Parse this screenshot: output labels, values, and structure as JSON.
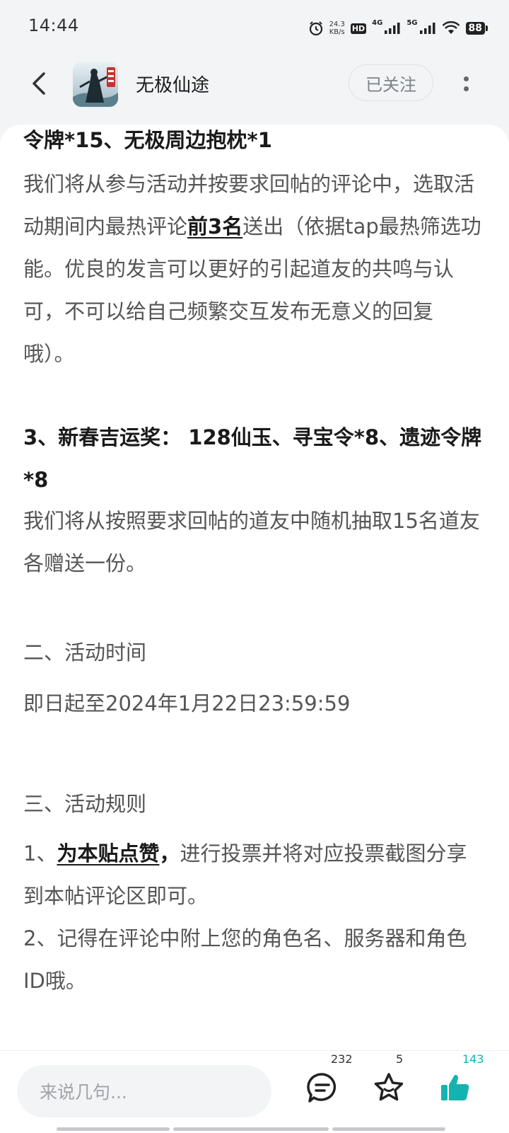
{
  "status_bar": {
    "time": "14:44",
    "net_speed_value": "24.3",
    "net_speed_unit": "KB/s",
    "hd_label": "HD",
    "sig1_label": "4G",
    "sig2_label": "5G",
    "battery": "88"
  },
  "header": {
    "title": "无极仙途",
    "follow_label": "已关注"
  },
  "content": {
    "p1": "令牌*15、无极周边抱枕*1",
    "p2_before": "我们将从参与活动并按要求回帖的评论中，选取活动期间内最热评论",
    "p2_bold": "前3名",
    "p2_after": "送出（依据tap最热筛选功能。优良的发言可以更好的引起道友的共鸣与认可，不可以给自己频繁交互发布无意义的回复哦）。",
    "p3": "3、新春吉运奖： 128仙玉、寻宝令*8、遗迹令牌*8",
    "p4": "我们将从按照要求回帖的道友中随机抽取15名道友各赠送一份。",
    "h2": "二、活动时间",
    "p5": "即日起至2024年1月22日23:59:59",
    "h3": "三、活动规则",
    "rule1_prefix": "1、",
    "rule1_bold": "为本贴点赞",
    "rule1_comma": "，",
    "rule1_rest": "进行投票并将对应投票截图分享到本帖评论区即可。",
    "rule2": "2、记得在评论中附上您的角色名、服务器和角色ID哦。"
  },
  "bottom_bar": {
    "input_placeholder": "来说几句...",
    "comment_count": "232",
    "favorite_count": "5",
    "like_count": "143"
  },
  "colors": {
    "accent_teal": "#15b3b0",
    "background": "#f2f4f6"
  },
  "icons": {
    "back": "back-arrow-icon",
    "more": "more-vertical-icon",
    "comment": "comment-icon",
    "favorite": "star-icon",
    "like": "thumbs-up-icon"
  }
}
